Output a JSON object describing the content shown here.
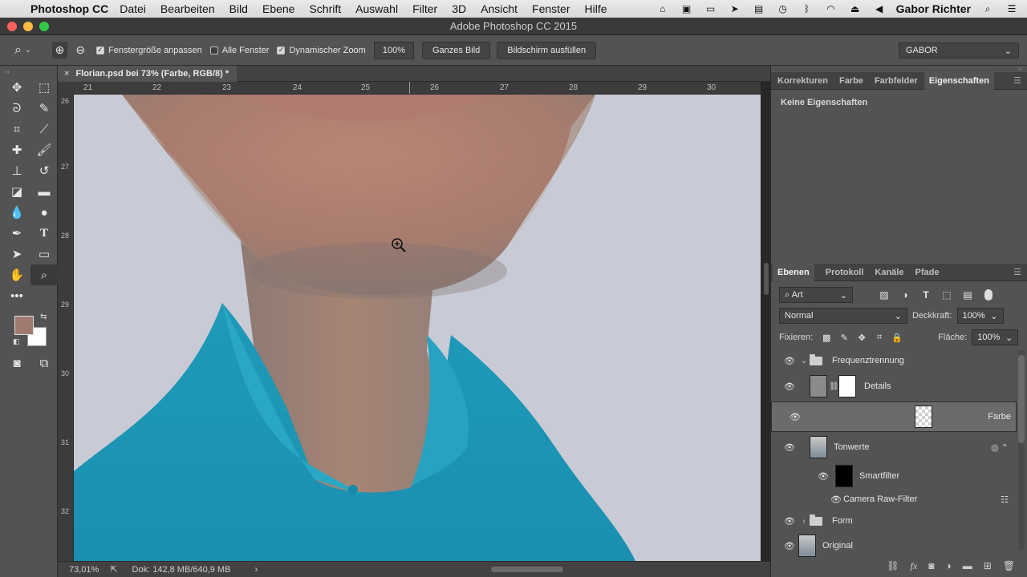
{
  "menubar": {
    "app_name": "Photoshop CC",
    "items": [
      "Datei",
      "Bearbeiten",
      "Bild",
      "Ebene",
      "Schrift",
      "Auswahl",
      "Filter",
      "3D",
      "Ansicht",
      "Fenster",
      "Hilfe"
    ],
    "user": "Gabor Richter"
  },
  "window": {
    "title": "Adobe Photoshop CC 2015"
  },
  "options_bar": {
    "resize_windows_label": "Fenstergröße anpassen",
    "resize_windows_checked": true,
    "all_windows_label": "Alle Fenster",
    "all_windows_checked": false,
    "scrubby_zoom_label": "Dynamischer Zoom",
    "scrubby_zoom_checked": true,
    "zoom_100_label": "100%",
    "fit_screen_label": "Ganzes Bild",
    "fill_screen_label": "Bildschirm ausfüllen",
    "workspace_value": "GABOR"
  },
  "document": {
    "tab_title": "Florian.psd bei 73% (Farbe, RGB/8) *",
    "ruler_h": [
      "21",
      "22",
      "23",
      "24",
      "25",
      "26",
      "27",
      "28",
      "29",
      "30"
    ],
    "ruler_v": [
      "26",
      "27",
      "28",
      "29",
      "30",
      "31",
      "32"
    ]
  },
  "status_bar": {
    "zoom": "73,01%",
    "doc_info": "Dok: 142,8 MB/640,9 MB"
  },
  "properties_panel": {
    "tabs": [
      "Korrekturen",
      "Farbe",
      "Farbfelder",
      "Eigenschaften"
    ],
    "active_tab": "Eigenschaften",
    "content": "Keine Eigenschaften"
  },
  "layers_panel": {
    "tabs": [
      "Ebenen",
      "Protokoll",
      "Kanäle",
      "Pfade"
    ],
    "active_tab": "Ebenen",
    "filter_value": "Art",
    "blend_mode": "Normal",
    "opacity_label": "Deckkraft:",
    "opacity_value": "100%",
    "lock_label": "Fixieren:",
    "fill_label": "Fläche:",
    "fill_value": "100%",
    "layers": [
      {
        "name": "Frequenztrennung",
        "kind": "group",
        "expanded": true
      },
      {
        "name": "Details",
        "kind": "layer-with-mask"
      },
      {
        "name": "Farbe",
        "kind": "layer",
        "selected": true
      },
      {
        "name": "Tonwerte",
        "kind": "smart-object"
      },
      {
        "name": "Smartfilter",
        "kind": "smart-filter"
      },
      {
        "name": "Camera Raw-Filter",
        "kind": "filter"
      },
      {
        "name": "Form",
        "kind": "group",
        "expanded": false
      },
      {
        "name": "Original",
        "kind": "smart-object"
      }
    ]
  },
  "colors": {
    "foreground": "#a07a6f",
    "background": "#ffffff",
    "accent_title": "#3a3a3a"
  }
}
